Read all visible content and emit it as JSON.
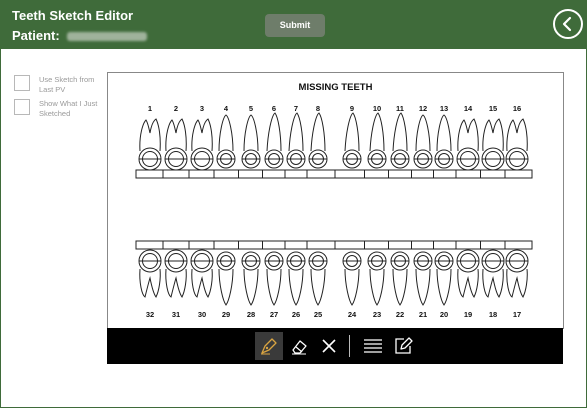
{
  "header": {
    "title": "Teeth Sketch Editor",
    "patient_label": "Patient:",
    "submit_label": "Submit",
    "back_icon": "chevron-left-circle-icon",
    "color": "#3f6b3a"
  },
  "options": [
    {
      "label": "Use Sketch from Last PV",
      "checked": false
    },
    {
      "label": "Show What I Just Sketched",
      "checked": false
    }
  ],
  "chart": {
    "title": "MISSING TEETH",
    "upper_numbers": [
      "1",
      "2",
      "3",
      "4",
      "5",
      "6",
      "7",
      "8",
      "9",
      "10",
      "11",
      "12",
      "13",
      "14",
      "15",
      "16"
    ],
    "lower_numbers": [
      "32",
      "31",
      "30",
      "29",
      "28",
      "27",
      "26",
      "25",
      "24",
      "23",
      "22",
      "21",
      "20",
      "19",
      "18",
      "17"
    ]
  },
  "toolbar": {
    "tools": [
      {
        "name": "pen-tool",
        "icon": "pen-icon",
        "active": true
      },
      {
        "name": "eraser-tool",
        "icon": "eraser-icon",
        "active": false
      },
      {
        "name": "clear-tool",
        "icon": "close-icon",
        "active": false
      },
      {
        "name": "line-weight-tool",
        "icon": "lines-icon",
        "active": false
      },
      {
        "name": "edit-tool",
        "icon": "edit-icon",
        "active": false
      }
    ]
  }
}
